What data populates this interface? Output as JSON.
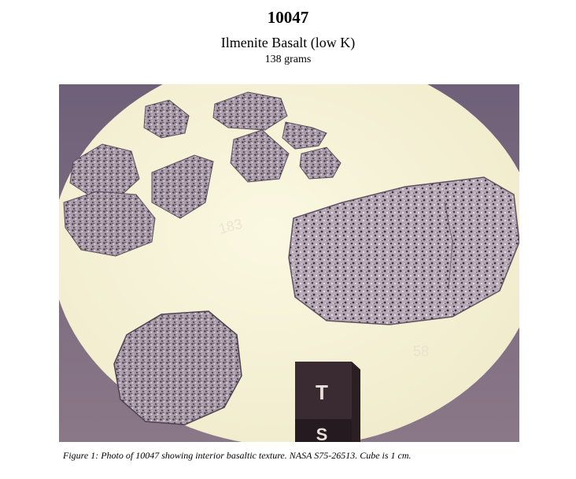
{
  "header": {
    "sample_number": "10047",
    "rock_type": "Ilmenite Basalt (low K)",
    "mass": "138 grams"
  },
  "figure": {
    "caption": "Figure 1:  Photo of 10047 showing interior basaltic texture.  NASA S75-26513.  Cube is 1 cm.",
    "cube_top_label": "T",
    "cube_bottom_label": "S"
  }
}
